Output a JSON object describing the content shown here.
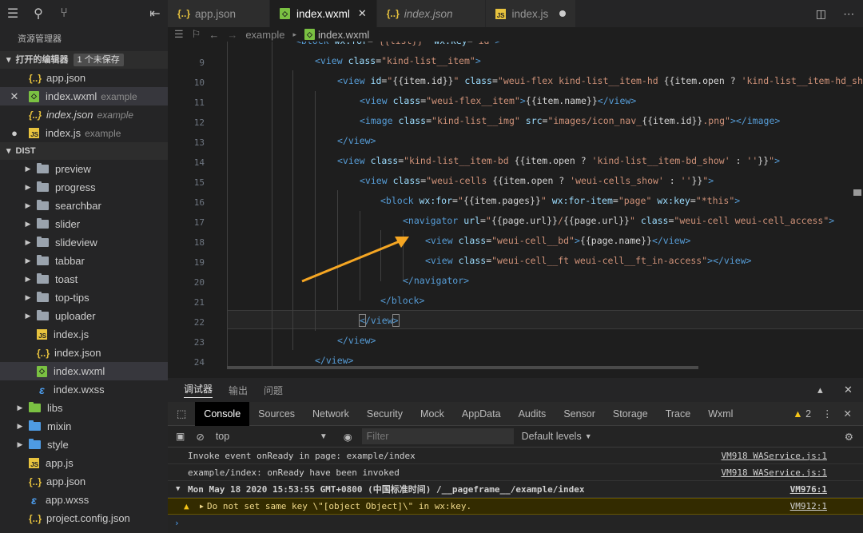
{
  "sidebar": {
    "title": "资源管理器",
    "open_editors": {
      "label": "打开的编辑器",
      "badge": "1 个未保存"
    },
    "open_files": [
      {
        "name": "app.json",
        "desc": "",
        "type": "json"
      },
      {
        "name": "index.wxml",
        "desc": "example",
        "type": "wxml"
      },
      {
        "name": "index.json",
        "desc": "example",
        "type": "json"
      },
      {
        "name": "index.js",
        "desc": "example",
        "type": "js"
      }
    ],
    "dist_label": "DIST",
    "tree": [
      {
        "name": "preview",
        "type": "folder"
      },
      {
        "name": "progress",
        "type": "folder"
      },
      {
        "name": "searchbar",
        "type": "folder"
      },
      {
        "name": "slider",
        "type": "folder"
      },
      {
        "name": "slideview",
        "type": "folder"
      },
      {
        "name": "tabbar",
        "type": "folder"
      },
      {
        "name": "toast",
        "type": "folder"
      },
      {
        "name": "top-tips",
        "type": "folder"
      },
      {
        "name": "uploader",
        "type": "folder"
      },
      {
        "name": "index.js",
        "type": "js"
      },
      {
        "name": "index.json",
        "type": "json"
      },
      {
        "name": "index.wxml",
        "type": "wxml"
      },
      {
        "name": "index.wxss",
        "type": "wxss"
      },
      {
        "name": "libs",
        "type": "folder"
      },
      {
        "name": "mixin",
        "type": "folder"
      },
      {
        "name": "style",
        "type": "folder"
      },
      {
        "name": "app.js",
        "type": "js"
      },
      {
        "name": "app.json",
        "type": "json"
      },
      {
        "name": "app.wxss",
        "type": "wxss"
      },
      {
        "name": "project.config.json",
        "type": "json"
      }
    ]
  },
  "tabs": [
    {
      "label": "app.json",
      "type": "json"
    },
    {
      "label": "index.wxml",
      "type": "wxml"
    },
    {
      "label": "index.json",
      "type": "json"
    },
    {
      "label": "index.js",
      "type": "js"
    }
  ],
  "breadcrumb": {
    "folder": "example",
    "file": "index.wxml"
  },
  "editor": {
    "line_numbers": [
      "9",
      "10",
      "11",
      "12",
      "13",
      "14",
      "15",
      "16",
      "17",
      "18",
      "19",
      "20",
      "21",
      "22",
      "23",
      "24"
    ]
  },
  "panel": {
    "tabs": [
      "调试器",
      "输出",
      "问题"
    ],
    "devtools_tabs": [
      "Console",
      "Sources",
      "Network",
      "Security",
      "Mock",
      "AppData",
      "Audits",
      "Sensor",
      "Storage",
      "Trace",
      "Wxml"
    ],
    "warning_count": "2",
    "context": "top",
    "filter_placeholder": "Filter",
    "levels": "Default levels",
    "logs": [
      {
        "text": "Invoke event onReady in page: example/index",
        "src": "VM918 WAService.js:1"
      },
      {
        "text": "example/index: onReady have been invoked",
        "src": "VM918 WAService.js:1"
      },
      {
        "text": "Mon May 18 2020 15:53:55 GMT+0800 (中国标准时间) /__pageframe__/example/index",
        "src": "VM976:1"
      },
      {
        "text": "Do not set same key \\\"[object Object]\\\" in wx:key.",
        "src": "VM912:1"
      }
    ],
    "prompt": "›"
  },
  "colors": {
    "accent": "#f5a623",
    "tag": "#569cd6",
    "attr": "#9cdcfe",
    "string": "#ce9178"
  }
}
